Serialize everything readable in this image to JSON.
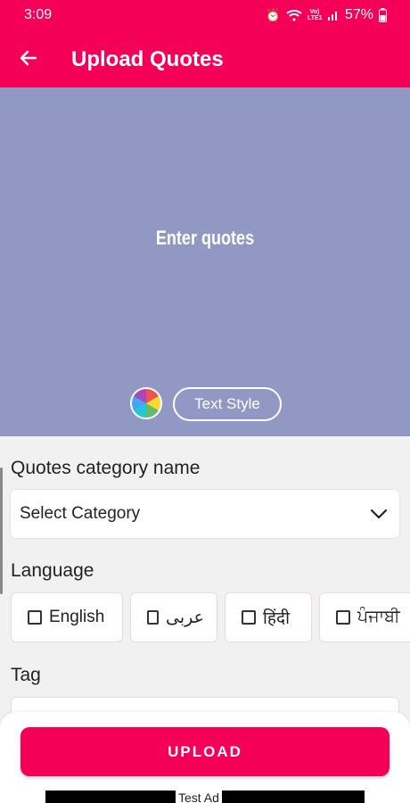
{
  "status_bar": {
    "time": "3:09",
    "battery": "57%",
    "network_badge": "Vo) LTE1"
  },
  "app_bar": {
    "title": "Upload Quotes"
  },
  "preview": {
    "quote_placeholder": "Enter quotes",
    "text_style_label": "Text Style",
    "background_color": "#9198c4"
  },
  "category": {
    "label": "Quotes category name",
    "selected": "Select Category"
  },
  "language": {
    "label": "Language",
    "options": [
      {
        "label": "English"
      },
      {
        "label": "عربى"
      },
      {
        "label": "हिंदी"
      },
      {
        "label": "ਪੰਜਾਬੀ"
      }
    ]
  },
  "tag": {
    "label": "Tag",
    "value": ""
  },
  "upload": {
    "label": "UPLOAD"
  },
  "ad": {
    "label": "Test Ad"
  },
  "colors": {
    "accent": "#f50057",
    "background": "#f1f1f1"
  }
}
